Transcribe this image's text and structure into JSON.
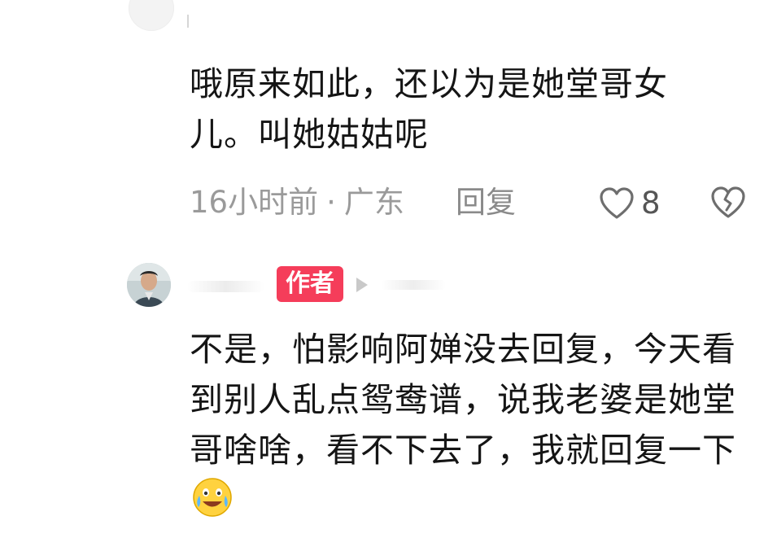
{
  "comment1": {
    "text": "哦原来如此，还以为是她堂哥女儿。叫她姑姑呢",
    "time": "16小时前",
    "separator": "·",
    "location": "广东",
    "reply_label": "回复",
    "like_count": "8",
    "icons": [
      "heart-outline-icon",
      "broken-heart-icon"
    ]
  },
  "comment2": {
    "badge": "作者",
    "text": "不是，怕影响阿婵没去回复，今天看到别人乱点鸳鸯谱，说我老婆是她堂哥啥啥，看不下去了，我就回复一下",
    "emoji": "grinning-tears-emoji"
  },
  "colors": {
    "badge_bg": "#f53d5a",
    "meta_text": "#9a9a9a",
    "body_text": "#151515"
  }
}
